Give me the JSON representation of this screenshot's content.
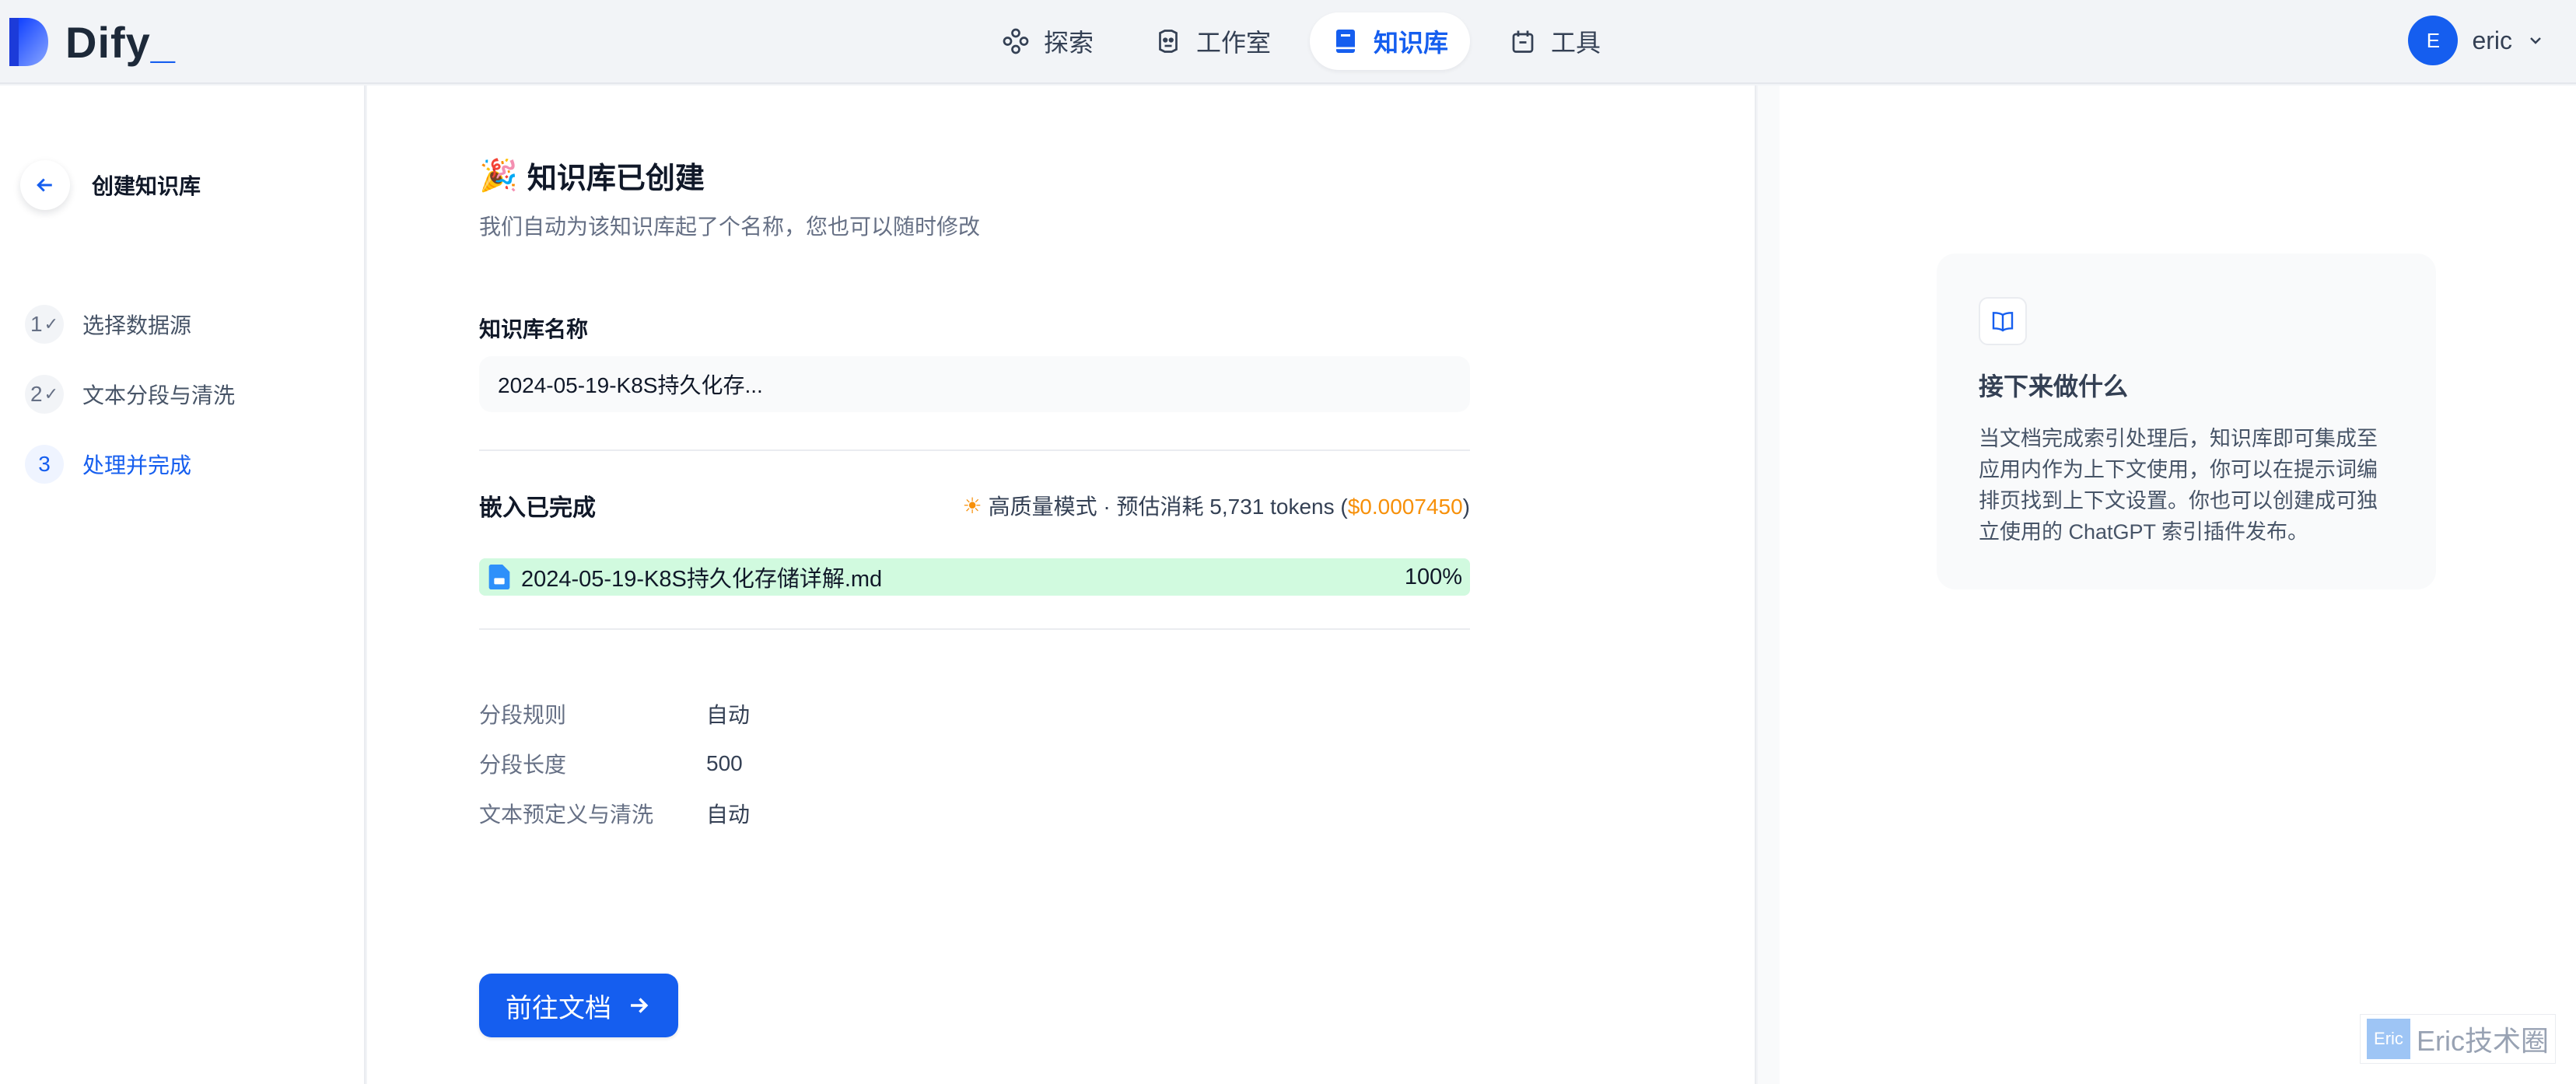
{
  "header": {
    "logo_text": "Dify",
    "logo_underscore": "_",
    "nav": [
      {
        "label": "探索",
        "icon": "explore-icon"
      },
      {
        "label": "工作室",
        "icon": "robot-icon"
      },
      {
        "label": "知识库",
        "icon": "book-icon",
        "active": true
      },
      {
        "label": "工具",
        "icon": "toolbox-icon"
      }
    ],
    "user": {
      "avatar_letter": "E",
      "name": "eric"
    }
  },
  "sidebar": {
    "back_title": "创建知识库",
    "steps": [
      {
        "num": "1",
        "check": "✓",
        "label": "选择数据源"
      },
      {
        "num": "2",
        "check": "✓",
        "label": "文本分段与清洗"
      },
      {
        "num": "3",
        "check": "",
        "label": "处理并完成"
      }
    ]
  },
  "main": {
    "emoji": "🎉",
    "title": "知识库已创建",
    "subtitle": "我们自动为该知识库起了个名称，您也可以随时修改",
    "name_label": "知识库名称",
    "name_value": "2024-05-19-K8S持久化存...",
    "embed_title": "嵌入已完成",
    "embed_meta_prefix": "高质量模式 · 预估消耗 5,731 tokens (",
    "embed_cost": "$0.0007450",
    "embed_meta_suffix": ")",
    "file": {
      "name": "2024-05-19-K8S持久化存储详解.md",
      "progress_label": "100%",
      "progress": 1.0
    },
    "rules": [
      {
        "key": "分段规则",
        "value": "自动"
      },
      {
        "key": "分段长度",
        "value": "500"
      },
      {
        "key": "文本预定义与清洗",
        "value": "自动"
      }
    ],
    "go_button": "前往文档"
  },
  "tip": {
    "title": "接下来做什么",
    "body": "当文档完成索引处理后，知识库即可集成至应用内作为上下文使用，你可以在提示词编排页找到上下文设置。你也可以创建成可独立使用的 ChatGPT 索引插件发布。"
  },
  "watermark": {
    "badge": "Eric",
    "text": "Eric技术圈"
  },
  "colors": {
    "accent": "#155eef",
    "progress_fill": "#d1fadf",
    "cost": "#f79009"
  }
}
